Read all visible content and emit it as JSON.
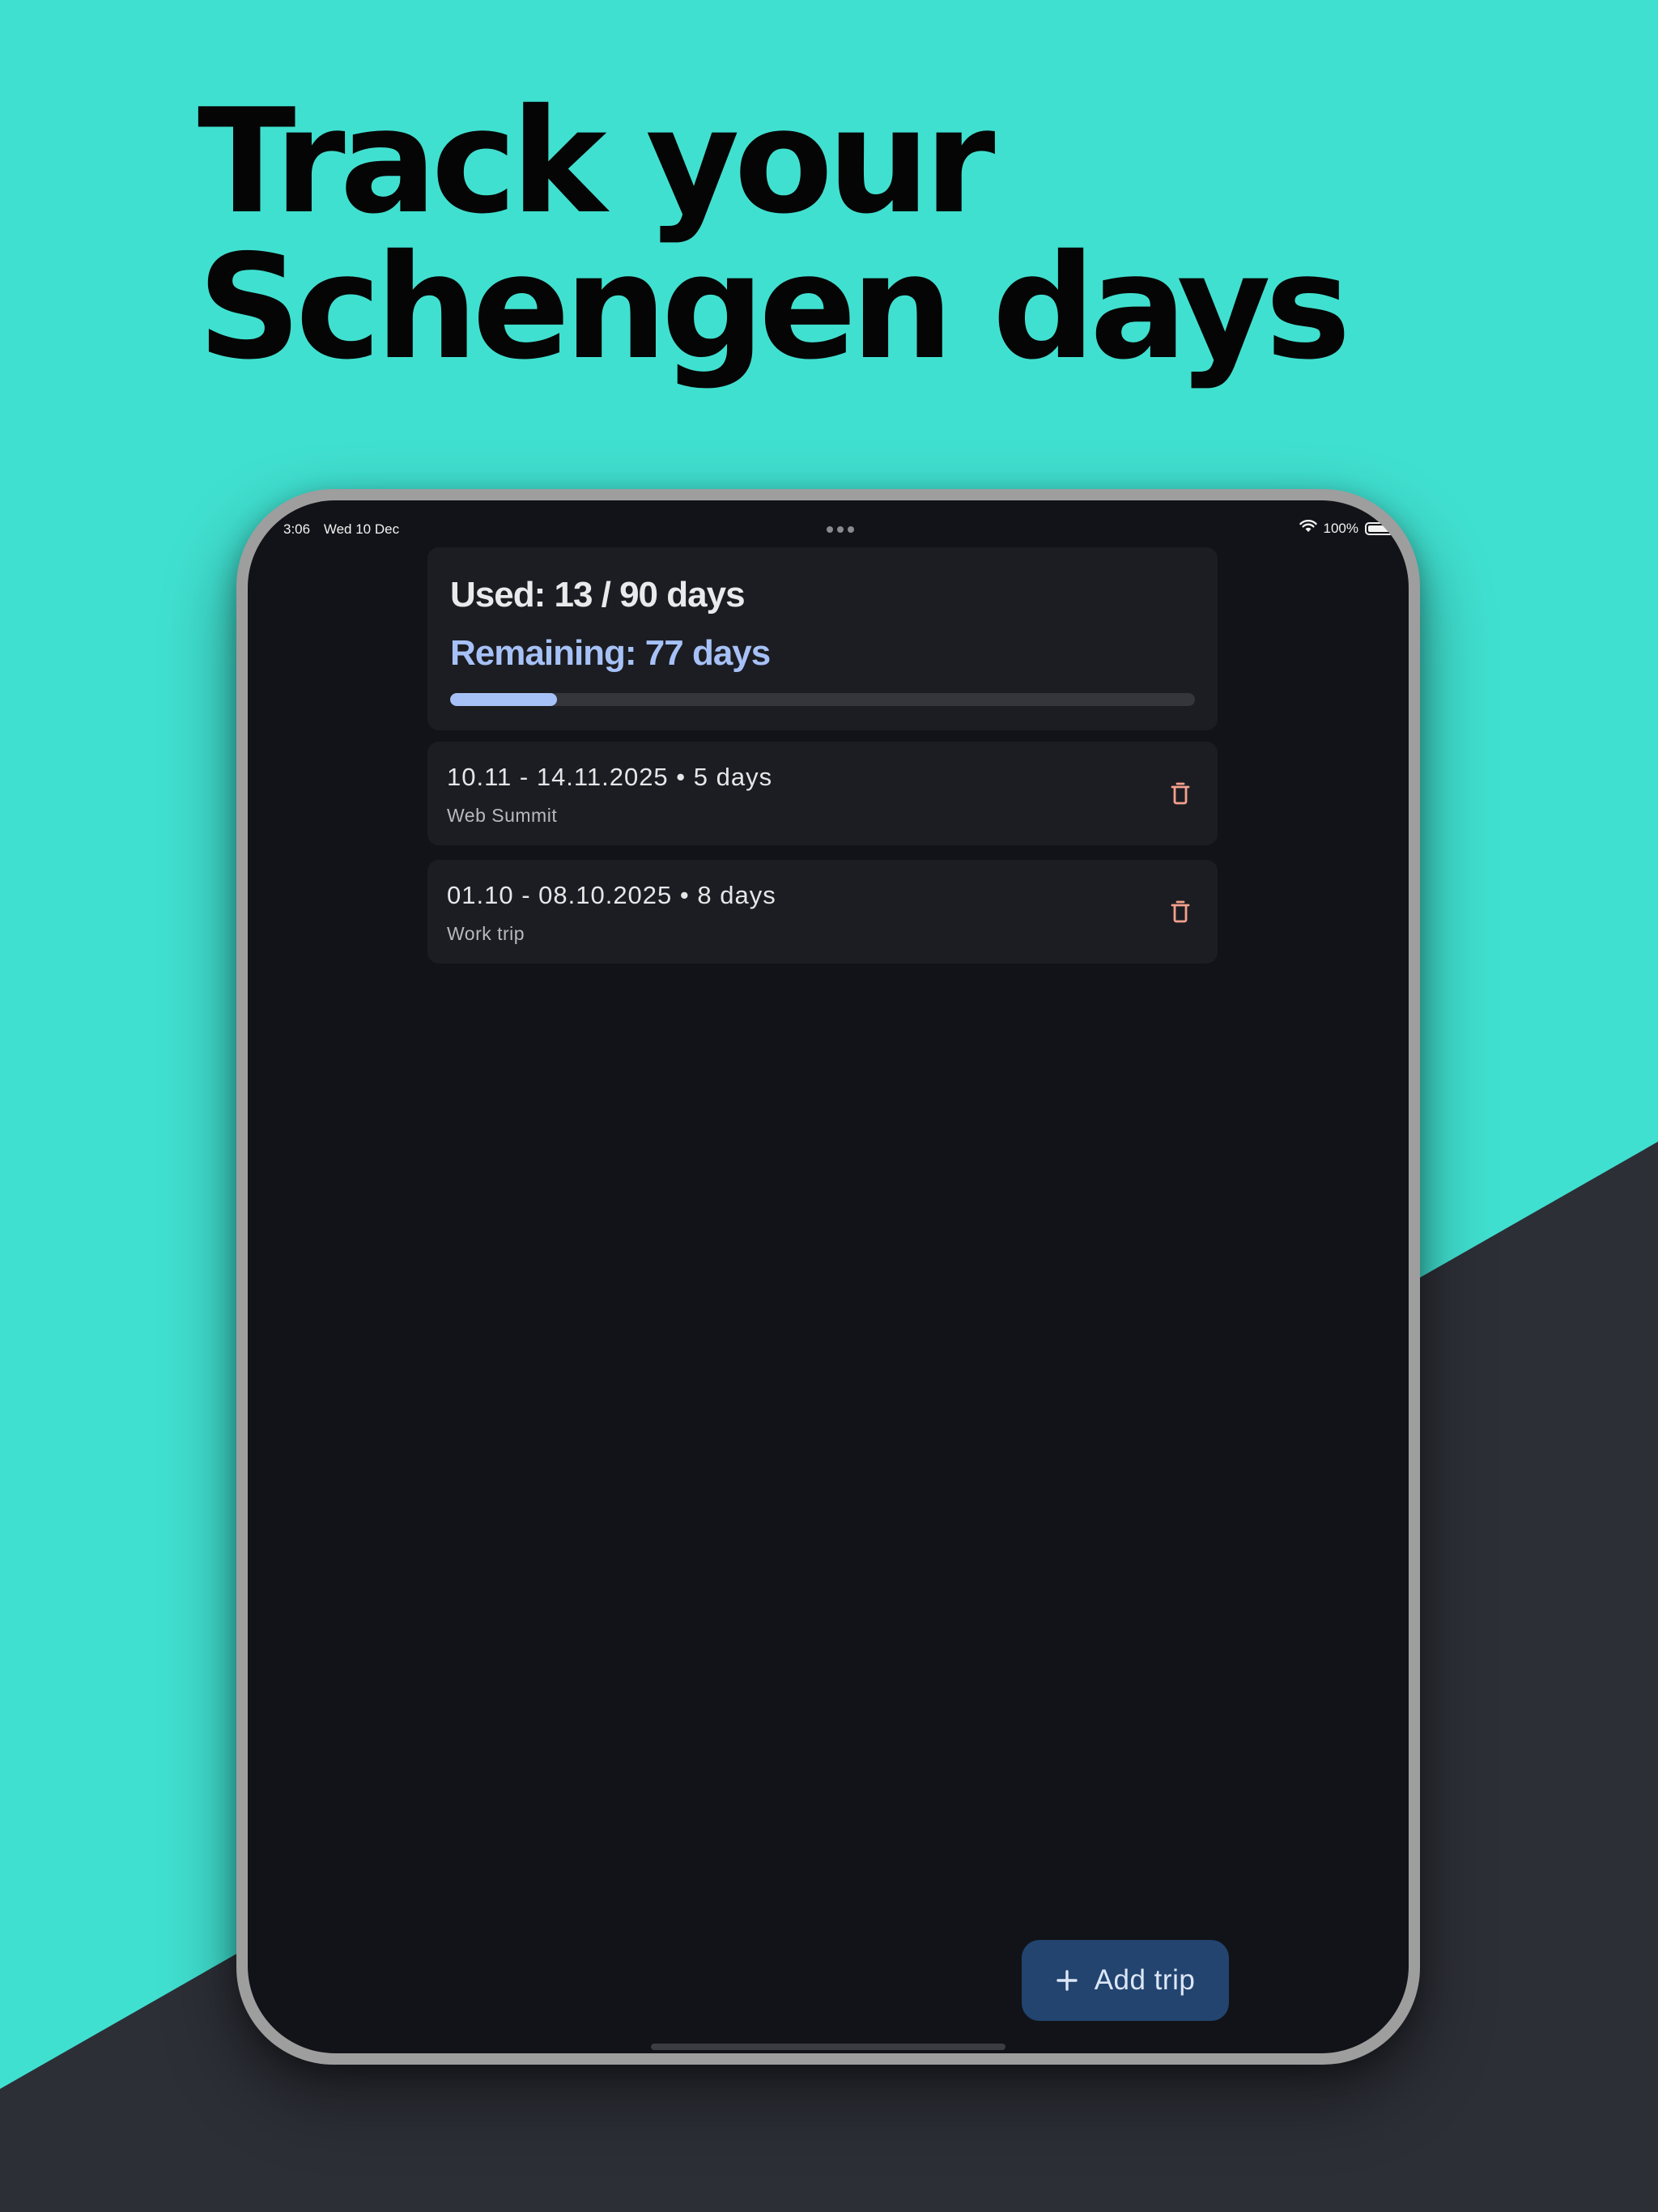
{
  "headline": {
    "line1": "Track your",
    "line2": "Schengen days"
  },
  "statusbar": {
    "time": "3:06",
    "date": "Wed 10 Dec",
    "battery": "100%",
    "icons": [
      "wifi-icon",
      "battery-icon"
    ]
  },
  "summary": {
    "used_text": "Used: 13 / 90 days",
    "remaining_text": "Remaining: 77 days",
    "used": 13,
    "limit": 90,
    "progress_fraction": 0.144
  },
  "trips": [
    {
      "title": "10.11 - 14.11.2025 • 5 days",
      "note": "Web Summit",
      "icon": "trash-icon"
    },
    {
      "title": "01.10 - 08.10.2025 • 8 days",
      "note": "Work trip",
      "icon": "trash-icon"
    }
  ],
  "fab": {
    "label": "Add trip",
    "icon": "plus-icon"
  },
  "colors": {
    "background": "#40e0d0",
    "slant": "#2d2f37",
    "screen": "#121318",
    "card": "#1c1d22",
    "accent": "#a6c1f7",
    "delete": "#f4a08d",
    "fab": "#22446f"
  }
}
